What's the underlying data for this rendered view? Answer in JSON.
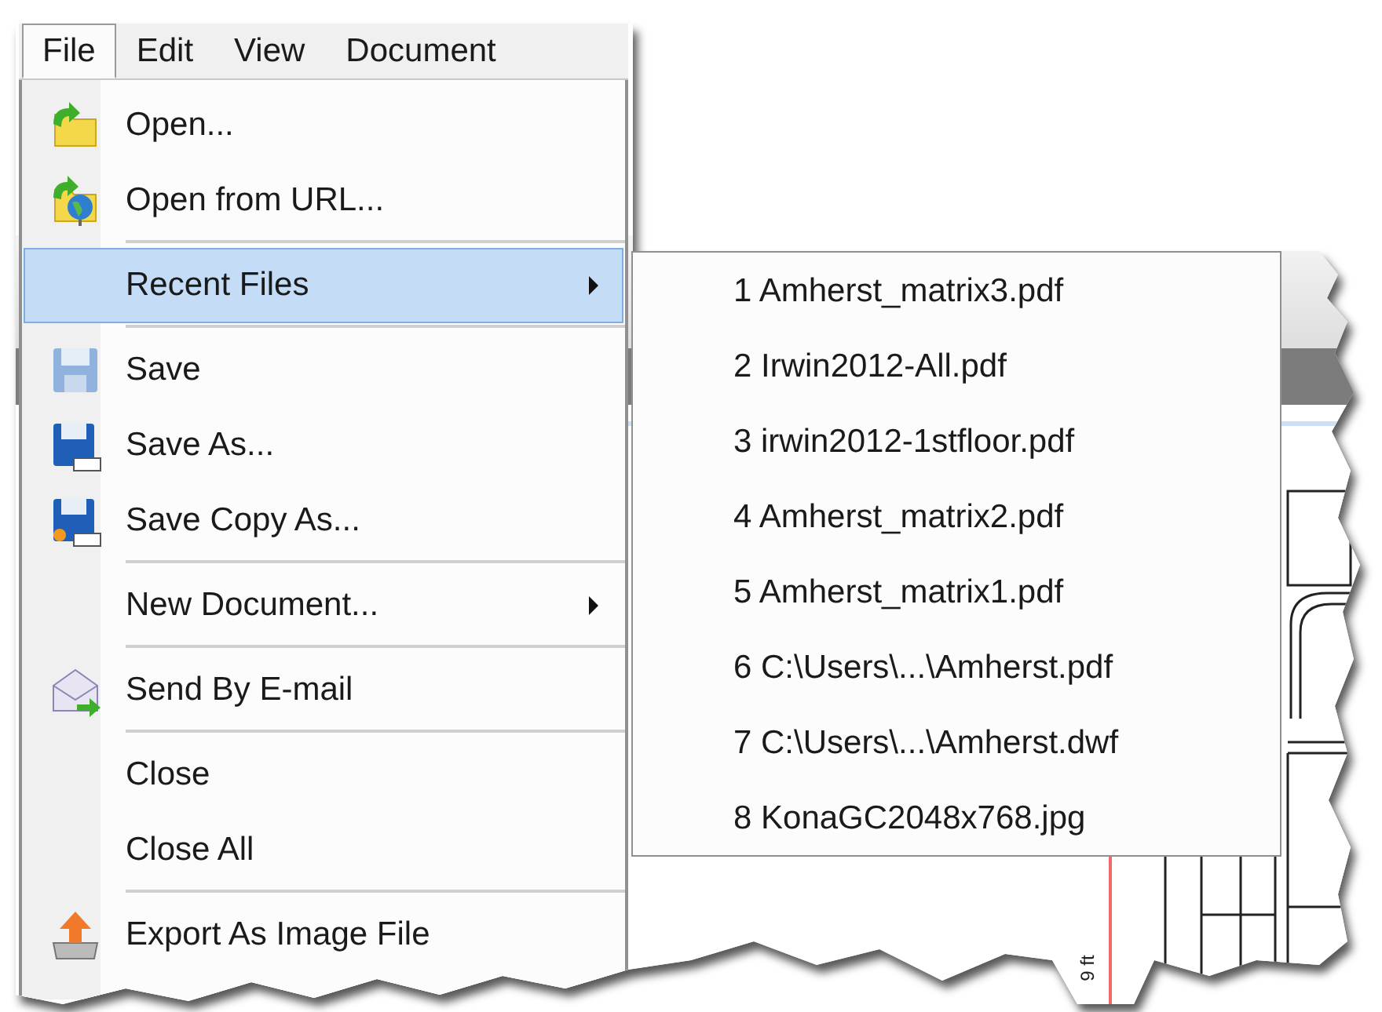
{
  "menubar": [
    {
      "label": "File",
      "selected": true
    },
    {
      "label": "Edit",
      "selected": false
    },
    {
      "label": "View",
      "selected": false
    },
    {
      "label": "Document",
      "selected": false
    }
  ],
  "file_menu": [
    {
      "kind": "item",
      "label": "Open...",
      "selected": false,
      "has_submenu": false
    },
    {
      "kind": "item",
      "label": "Open from URL...",
      "selected": false,
      "has_submenu": false
    },
    {
      "kind": "separator"
    },
    {
      "kind": "item",
      "label": "Recent Files",
      "selected": true,
      "has_submenu": true
    },
    {
      "kind": "separator"
    },
    {
      "kind": "item",
      "label": "Save",
      "selected": false,
      "has_submenu": false
    },
    {
      "kind": "item",
      "label": "Save As...",
      "selected": false,
      "has_submenu": false
    },
    {
      "kind": "item",
      "label": "Save Copy As...",
      "selected": false,
      "has_submenu": false
    },
    {
      "kind": "separator"
    },
    {
      "kind": "item",
      "label": "New Document...",
      "selected": false,
      "has_submenu": true
    },
    {
      "kind": "separator"
    },
    {
      "kind": "item",
      "label": "Send By E-mail",
      "selected": false,
      "has_submenu": false
    },
    {
      "kind": "separator"
    },
    {
      "kind": "item",
      "label": "Close",
      "selected": false,
      "has_submenu": false
    },
    {
      "kind": "item",
      "label": "Close All",
      "selected": false,
      "has_submenu": false
    },
    {
      "kind": "separator"
    },
    {
      "kind": "item",
      "label": "Export As Image File",
      "selected": false,
      "has_submenu": false
    }
  ],
  "recent_files": [
    "1 Amherst_matrix3.pdf",
    "2 Irwin2012-All.pdf",
    "3 irwin2012-1stfloor.pdf",
    "4 Amherst_matrix2.pdf",
    "5 Amherst_matrix1.pdf",
    "6 C:\\Users\\...\\Amherst.pdf",
    "7 C:\\Users\\...\\Amherst.dwf",
    "8 KonaGC2048x768.jpg"
  ],
  "drawing": {
    "dimension_label": "9 ft"
  }
}
